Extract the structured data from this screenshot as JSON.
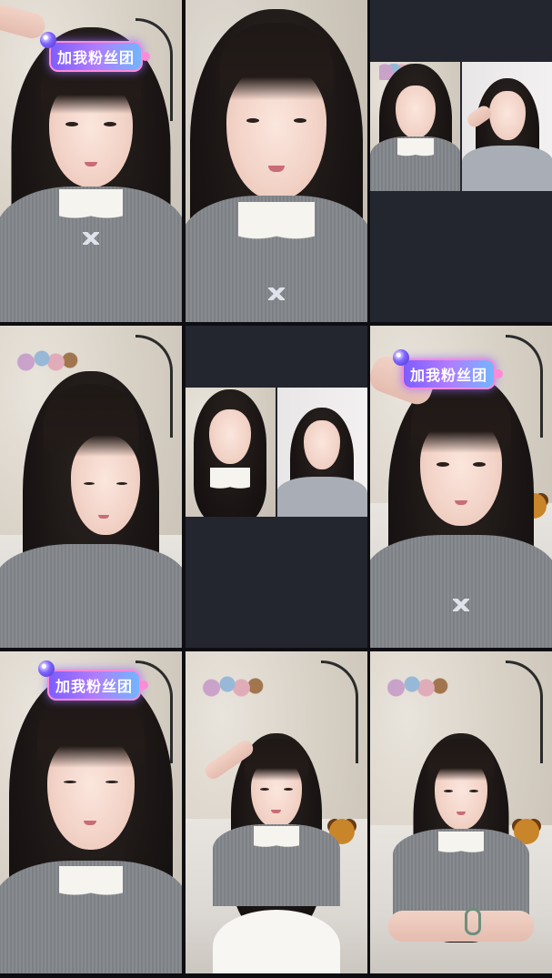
{
  "badge": {
    "label": "加我粉丝团"
  },
  "colors": {
    "badge_gradient": [
      "#7b5cff",
      "#b07cff",
      "#6fb8ff"
    ],
    "split_bg": "#23252f"
  }
}
